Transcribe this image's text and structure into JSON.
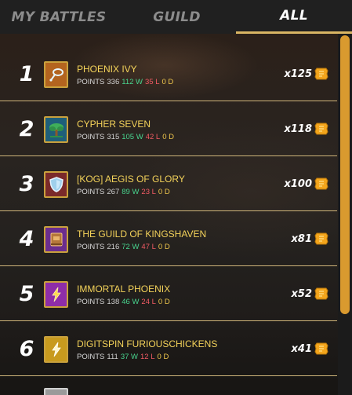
{
  "tabs": [
    {
      "label": "MY BATTLES"
    },
    {
      "label": "GUILD"
    },
    {
      "label": "ALL",
      "active": true
    }
  ],
  "stats_label": "POINTS",
  "leaderboard": [
    {
      "rank": "1",
      "name": "PHOENIX IVY",
      "points": "336",
      "wins": "112 W",
      "losses": "35 L",
      "draws": "0 D",
      "reward": "x125",
      "crest_icon": "lasso-icon",
      "crest_color": "#b3641f"
    },
    {
      "rank": "2",
      "name": "CYPHER SEVEN",
      "points": "315",
      "wins": "105 W",
      "losses": "42 L",
      "draws": "0 D",
      "reward": "x118",
      "crest_icon": "tree-icon",
      "crest_color": "#1e5f7a"
    },
    {
      "rank": "3",
      "name": "[KOG] AEGIS OF GLORY",
      "points": "267",
      "wins": "89 W",
      "losses": "23 L",
      "draws": "0 D",
      "reward": "x100",
      "crest_icon": "shield-icon",
      "crest_color": "#7a2a2a"
    },
    {
      "rank": "4",
      "name": "THE GUILD OF KINGSHAVEN",
      "points": "216",
      "wins": "72 W",
      "losses": "47 L",
      "draws": "0 D",
      "reward": "x81",
      "crest_icon": "book-icon",
      "crest_color": "#6b2d8e"
    },
    {
      "rank": "5",
      "name": "IMMORTAL PHOENIX",
      "points": "138",
      "wins": "46 W",
      "losses": "24 L",
      "draws": "0 D",
      "reward": "x52",
      "crest_icon": "lightning-icon",
      "crest_color": "#8e2da8"
    },
    {
      "rank": "6",
      "name": "DIGITSPIN FURIOUSCHICKENS",
      "points": "111",
      "wins": "37 W",
      "losses": "12 L",
      "draws": "0 D",
      "reward": "x41",
      "crest_icon": "lightning-icon",
      "crest_color": "#c89a1e"
    }
  ],
  "colors": {
    "accent_gold": "#d9b563",
    "guild_name": "#f4d35a",
    "win": "#48d48e",
    "loss": "#f05a63",
    "draw": "#f2c94c",
    "scrollbar_thumb": "#d99a2f"
  }
}
